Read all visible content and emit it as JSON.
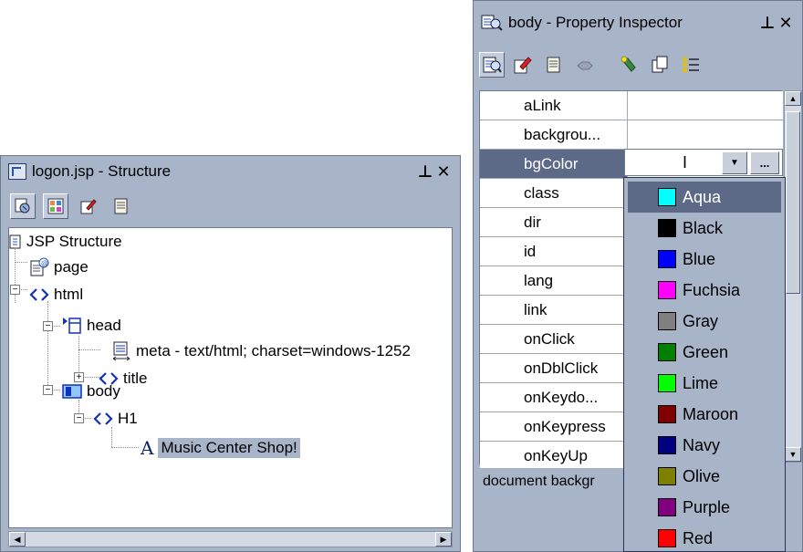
{
  "structure": {
    "title": "logon.jsp - Structure",
    "pin": "⊥",
    "close": "×",
    "toolbar": [
      "view-icon",
      "palette-icon",
      "edit-icon",
      "properties-icon"
    ],
    "tree": [
      {
        "label": "JSP Structure",
        "icon": "jsp-structure-icon"
      },
      {
        "label": "page",
        "icon": "page-icon"
      },
      {
        "label": "html",
        "icon": "tag-icon"
      },
      {
        "label": "head",
        "icon": "head-icon"
      },
      {
        "label": "meta - text/html; charset=windows-1252",
        "icon": "meta-icon"
      },
      {
        "label": "title",
        "icon": "tag-icon"
      },
      {
        "label": "body",
        "icon": "body-icon"
      },
      {
        "label": "H1",
        "icon": "tag-icon"
      },
      {
        "label": "Music Center Shop!",
        "icon": "text-icon"
      }
    ]
  },
  "inspector": {
    "title": "body - Property Inspector",
    "pin": "⊥",
    "close": "×",
    "toolbar": [
      "inspect-icon",
      "edit-icon",
      "properties-icon",
      "filter-icon",
      "flashlight-icon",
      "copy-icon",
      "list-icon"
    ],
    "properties": [
      "aLink",
      "backgrou...",
      "bgColor",
      "class",
      "dir",
      "id",
      "lang",
      "link",
      "onClick",
      "onDblClick",
      "onKeydo...",
      "onKeypress",
      "onKeyUp"
    ],
    "selected_property": "bgColor",
    "ellipsis": "...",
    "status": "document backgr"
  },
  "colors": [
    {
      "name": "Aqua",
      "hex": "#00ffff"
    },
    {
      "name": "Black",
      "hex": "#000000"
    },
    {
      "name": "Blue",
      "hex": "#0000ff"
    },
    {
      "name": "Fuchsia",
      "hex": "#ff00ff"
    },
    {
      "name": "Gray",
      "hex": "#808080"
    },
    {
      "name": "Green",
      "hex": "#008000"
    },
    {
      "name": "Lime",
      "hex": "#00ff00"
    },
    {
      "name": "Maroon",
      "hex": "#800000"
    },
    {
      "name": "Navy",
      "hex": "#000080"
    },
    {
      "name": "Olive",
      "hex": "#808000"
    },
    {
      "name": "Purple",
      "hex": "#800080"
    },
    {
      "name": "Red",
      "hex": "#ff0000"
    }
  ],
  "selected_color": "Aqua"
}
